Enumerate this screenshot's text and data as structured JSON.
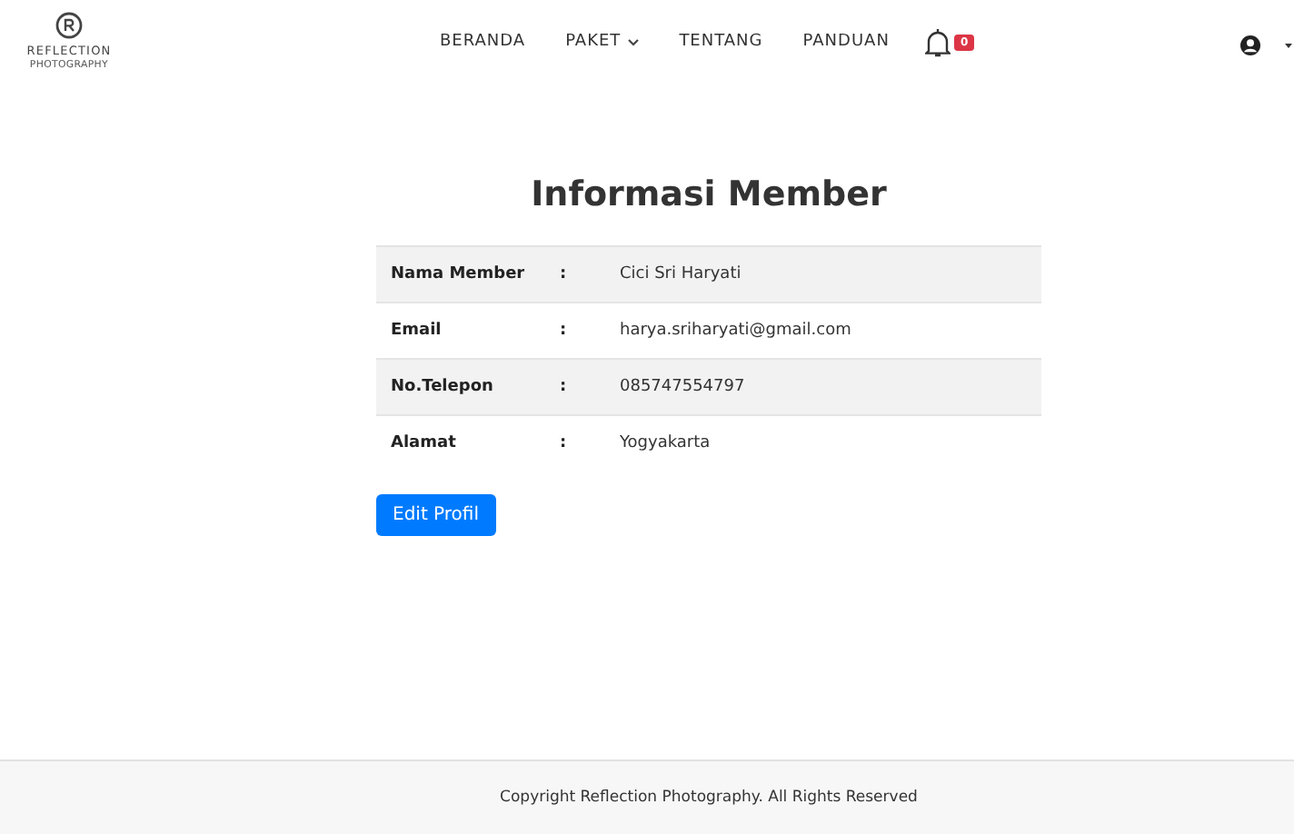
{
  "navbar": {
    "logo": {
      "name": "REFLECTION",
      "tagline": "PHOTOGRAPHY"
    },
    "items": [
      {
        "label": "BERANDA",
        "dropdown": false
      },
      {
        "label": "PAKET",
        "dropdown": true
      },
      {
        "label": "TENTANG",
        "dropdown": false
      },
      {
        "label": "PANDUAN",
        "dropdown": false
      }
    ],
    "notifications": {
      "count": "0"
    }
  },
  "title": "Informasi Member",
  "rows": [
    {
      "label": "Nama Member",
      "separator": ":",
      "value": "Cici Sri Haryati"
    },
    {
      "label": "Email",
      "separator": ":",
      "value": "harya.sriharyati@gmail.com"
    },
    {
      "label": "No.Telepon",
      "separator": ":",
      "value": "085747554797"
    },
    {
      "label": "Alamat",
      "separator": ":",
      "value": "Yogyakarta"
    }
  ],
  "button": "Edit Profil",
  "footer": "Copyright Reflection Photography. All Rights Reserved"
}
